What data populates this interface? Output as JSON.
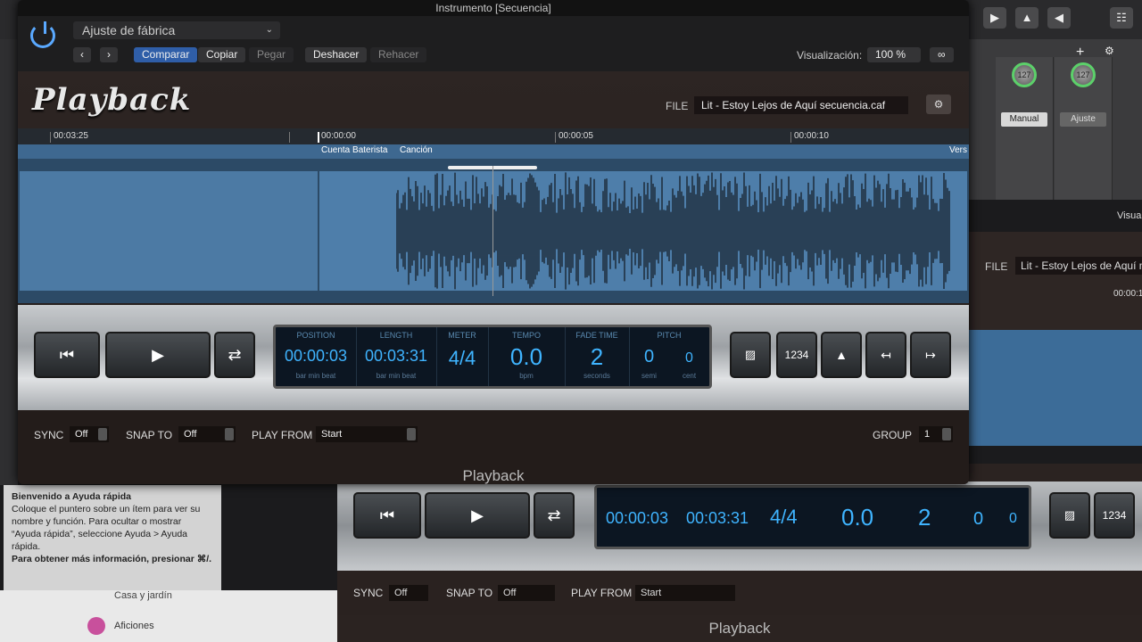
{
  "window": {
    "title": "Instrumento [Secuencia]"
  },
  "header": {
    "preset": "Ajuste de fábrica",
    "compare": "Comparar",
    "copy": "Copiar",
    "paste": "Pegar",
    "undo": "Deshacer",
    "redo": "Rehacer",
    "view_label": "Visualización:",
    "view_value": "100 %"
  },
  "plugin": {
    "logo": "Playback",
    "file_label": "FILE",
    "file_value": "Lit - Estoy Lejos de Aquí secuencia.caf",
    "name": "Playback"
  },
  "ruler": {
    "labels": [
      "00:03:25",
      "00:00:00",
      "00:00:05",
      "00:00:10"
    ],
    "markers": [
      "Cuenta Baterista",
      "Canción",
      "Vers"
    ]
  },
  "lcd": {
    "position": {
      "label": "POSITION",
      "value": "00:00:03",
      "sub": "bar   min   beat"
    },
    "length": {
      "label": "LENGTH",
      "value": "00:03:31",
      "sub": "bar   min   beat"
    },
    "meter": {
      "label": "METER",
      "value": "4/4"
    },
    "tempo": {
      "label": "TEMPO",
      "value": "0.0",
      "sub": "bpm"
    },
    "fade": {
      "label": "FADE TIME",
      "value": "2",
      "sub": "seconds"
    },
    "pitch": {
      "label": "PITCH",
      "semi": "0",
      "cent": "0",
      "sub_semi": "semi",
      "sub_cent": "cent"
    }
  },
  "transport_right": {
    "count_in": "1234"
  },
  "bottom": {
    "sync_label": "SYNC",
    "sync_value": "Off",
    "snap_label": "SNAP TO",
    "snap_value": "Off",
    "playfrom_label": "PLAY FROM",
    "playfrom_value": "Start",
    "group_label": "GROUP",
    "group_value": "1"
  },
  "quickhelp": {
    "title": "Bienvenido a Ayuda rápida",
    "body": "Coloque el puntero sobre un ítem para ver su nombre y función. Para ocultar o mostrar “Ayuda rápida”, seleccione Ayuda > Ayuda rápida.",
    "more": "Para obtener más información, presionar ⌘/."
  },
  "background": {
    "mixer_values": [
      "127",
      "127"
    ],
    "mixer_labels": [
      "Manual",
      "Ajuste"
    ],
    "visual_trunc": "Visua",
    "file_label": "FILE",
    "file_value": "Lit - Estoy Lejos de Aquí m",
    "time_trunc": "00:00:1",
    "lower_position": "00:00:03",
    "lower_length": "00:03:31",
    "lower_meter": "4/4",
    "lower_tempo": "0.0",
    "lower_fade": "2",
    "lower_semi": "0",
    "lower_cent": "0",
    "lower_sync": "Off",
    "lower_snap": "Off",
    "lower_playfrom": "Start",
    "lower_name": "Playback",
    "lower_count_in": "1234",
    "list_items": [
      "Casa y jardín",
      "Aficiones"
    ]
  }
}
